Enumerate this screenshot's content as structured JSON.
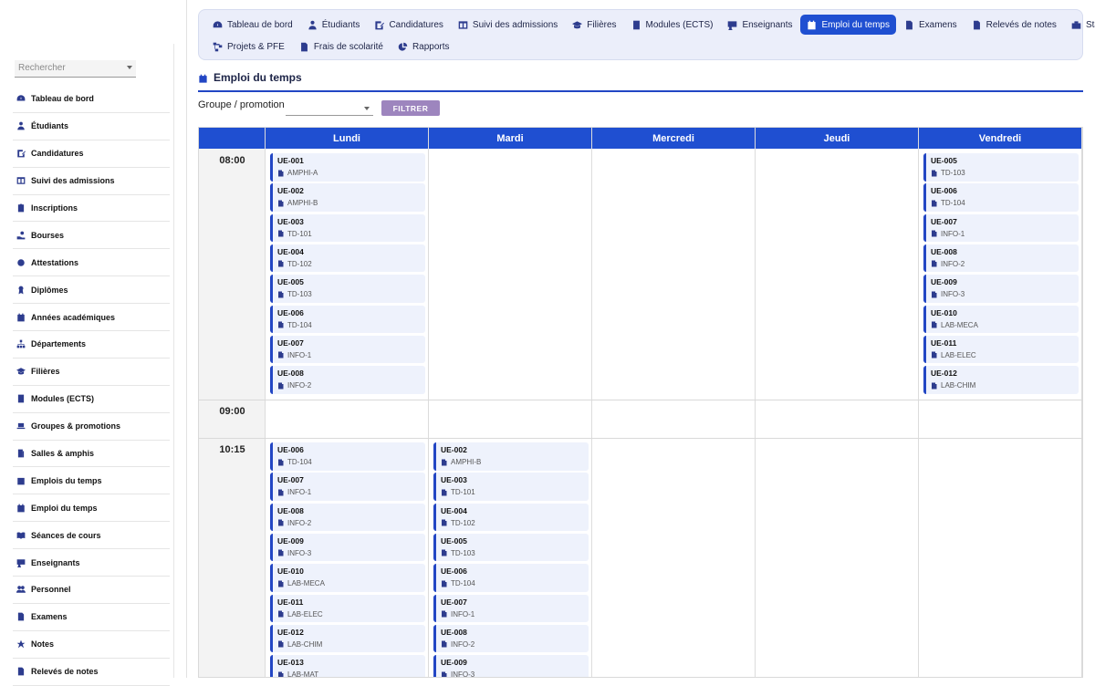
{
  "sidebar": {
    "search_placeholder": "Rechercher",
    "items": [
      {
        "label": "Tableau de bord",
        "icon": "gauge-icon"
      },
      {
        "label": "Étudiants",
        "icon": "student-icon"
      },
      {
        "label": "Candidatures",
        "icon": "edit-form-icon"
      },
      {
        "label": "Suivi des admissions",
        "icon": "table-columns-icon"
      },
      {
        "label": "Inscriptions",
        "icon": "clipboard-check-icon"
      },
      {
        "label": "Bourses",
        "icon": "hand-coin-icon"
      },
      {
        "label": "Attestations",
        "icon": "certificate-icon"
      },
      {
        "label": "Diplômes",
        "icon": "award-icon"
      },
      {
        "label": "Années académiques",
        "icon": "calendar-icon"
      },
      {
        "label": "Départements",
        "icon": "sitemap-icon"
      },
      {
        "label": "Filières",
        "icon": "graduation-cap-icon"
      },
      {
        "label": "Modules (ECTS)",
        "icon": "book-icon"
      },
      {
        "label": "Groupes & promotions",
        "icon": "laptop-icon"
      },
      {
        "label": "Salles & amphis",
        "icon": "door-icon"
      },
      {
        "label": "Emplois du temps",
        "icon": "calendar-list-icon"
      },
      {
        "label": "Emploi du temps",
        "icon": "calendar-day-icon"
      },
      {
        "label": "Séances de cours",
        "icon": "book-open-icon"
      },
      {
        "label": "Enseignants",
        "icon": "teacher-icon"
      },
      {
        "label": "Personnel",
        "icon": "users-icon"
      },
      {
        "label": "Examens",
        "icon": "file-alt-icon"
      },
      {
        "label": "Notes",
        "icon": "star-icon"
      },
      {
        "label": "Relevés de notes",
        "icon": "file-lines-icon"
      }
    ]
  },
  "topnav": {
    "row1": [
      {
        "label": "Tableau de bord",
        "icon": "gauge-icon",
        "active": false
      },
      {
        "label": "Étudiants",
        "icon": "student-icon",
        "active": false
      },
      {
        "label": "Candidatures",
        "icon": "edit-form-icon",
        "active": false
      },
      {
        "label": "Suivi des admissions",
        "icon": "table-columns-icon",
        "active": false
      },
      {
        "label": "Filières",
        "icon": "graduation-cap-icon",
        "active": false
      },
      {
        "label": "Modules (ECTS)",
        "icon": "book-icon",
        "active": false
      },
      {
        "label": "Enseignants",
        "icon": "teacher-icon",
        "active": false
      },
      {
        "label": "Emploi du temps",
        "icon": "calendar-day-icon",
        "active": true
      },
      {
        "label": "Examens",
        "icon": "file-alt-icon",
        "active": false
      },
      {
        "label": "Relevés de notes",
        "icon": "file-lines-icon",
        "active": false
      },
      {
        "label": "Stages",
        "icon": "briefcase-icon",
        "active": false
      }
    ],
    "row2": [
      {
        "label": "Projets & PFE",
        "icon": "project-diagram-icon",
        "active": false
      },
      {
        "label": "Frais de scolarité",
        "icon": "file-invoice-icon",
        "active": false
      },
      {
        "label": "Rapports",
        "icon": "pie-chart-icon",
        "active": false
      }
    ]
  },
  "page": {
    "title": "Emploi du temps",
    "filter_label": "Groupe / promotion",
    "filter_value": "",
    "filter_button": "FILTRER"
  },
  "timetable": {
    "days": [
      "Lundi",
      "Mardi",
      "Mercredi",
      "Jeudi",
      "Vendredi"
    ],
    "slots": [
      {
        "time": "08:00",
        "cells": [
          [
            [
              "UE-001",
              "AMPHI-A"
            ],
            [
              "UE-002",
              "AMPHI-B"
            ],
            [
              "UE-003",
              "TD-101"
            ],
            [
              "UE-004",
              "TD-102"
            ],
            [
              "UE-005",
              "TD-103"
            ],
            [
              "UE-006",
              "TD-104"
            ],
            [
              "UE-007",
              "INFO-1"
            ],
            [
              "UE-008",
              "INFO-2"
            ]
          ],
          [],
          [],
          [],
          [
            [
              "UE-005",
              "TD-103"
            ],
            [
              "UE-006",
              "TD-104"
            ],
            [
              "UE-007",
              "INFO-1"
            ],
            [
              "UE-008",
              "INFO-2"
            ],
            [
              "UE-009",
              "INFO-3"
            ],
            [
              "UE-010",
              "LAB-MECA"
            ],
            [
              "UE-011",
              "LAB-ELEC"
            ],
            [
              "UE-012",
              "LAB-CHIM"
            ]
          ]
        ]
      },
      {
        "time": "09:00",
        "cells": [
          [],
          [],
          [],
          [],
          []
        ]
      },
      {
        "time": "10:15",
        "cells": [
          [
            [
              "UE-006",
              "TD-104"
            ],
            [
              "UE-007",
              "INFO-1"
            ],
            [
              "UE-008",
              "INFO-2"
            ],
            [
              "UE-009",
              "INFO-3"
            ],
            [
              "UE-010",
              "LAB-MECA"
            ],
            [
              "UE-011",
              "LAB-ELEC"
            ],
            [
              "UE-012",
              "LAB-CHIM"
            ],
            [
              "UE-013",
              "LAB-MAT"
            ]
          ],
          [
            [
              "UE-002",
              "AMPHI-B"
            ],
            [
              "UE-003",
              "TD-101"
            ],
            [
              "UE-004",
              "TD-102"
            ],
            [
              "UE-005",
              "TD-103"
            ],
            [
              "UE-006",
              "TD-104"
            ],
            [
              "UE-007",
              "INFO-1"
            ],
            [
              "UE-008",
              "INFO-2"
            ],
            [
              "UE-009",
              "INFO-3"
            ]
          ],
          [],
          [],
          []
        ]
      }
    ]
  },
  "colors": {
    "accent": "#1f4fd1",
    "nav_bg": "#ebeefa",
    "filter_button": "#9d85be",
    "card_bg": "#eef2fc"
  }
}
